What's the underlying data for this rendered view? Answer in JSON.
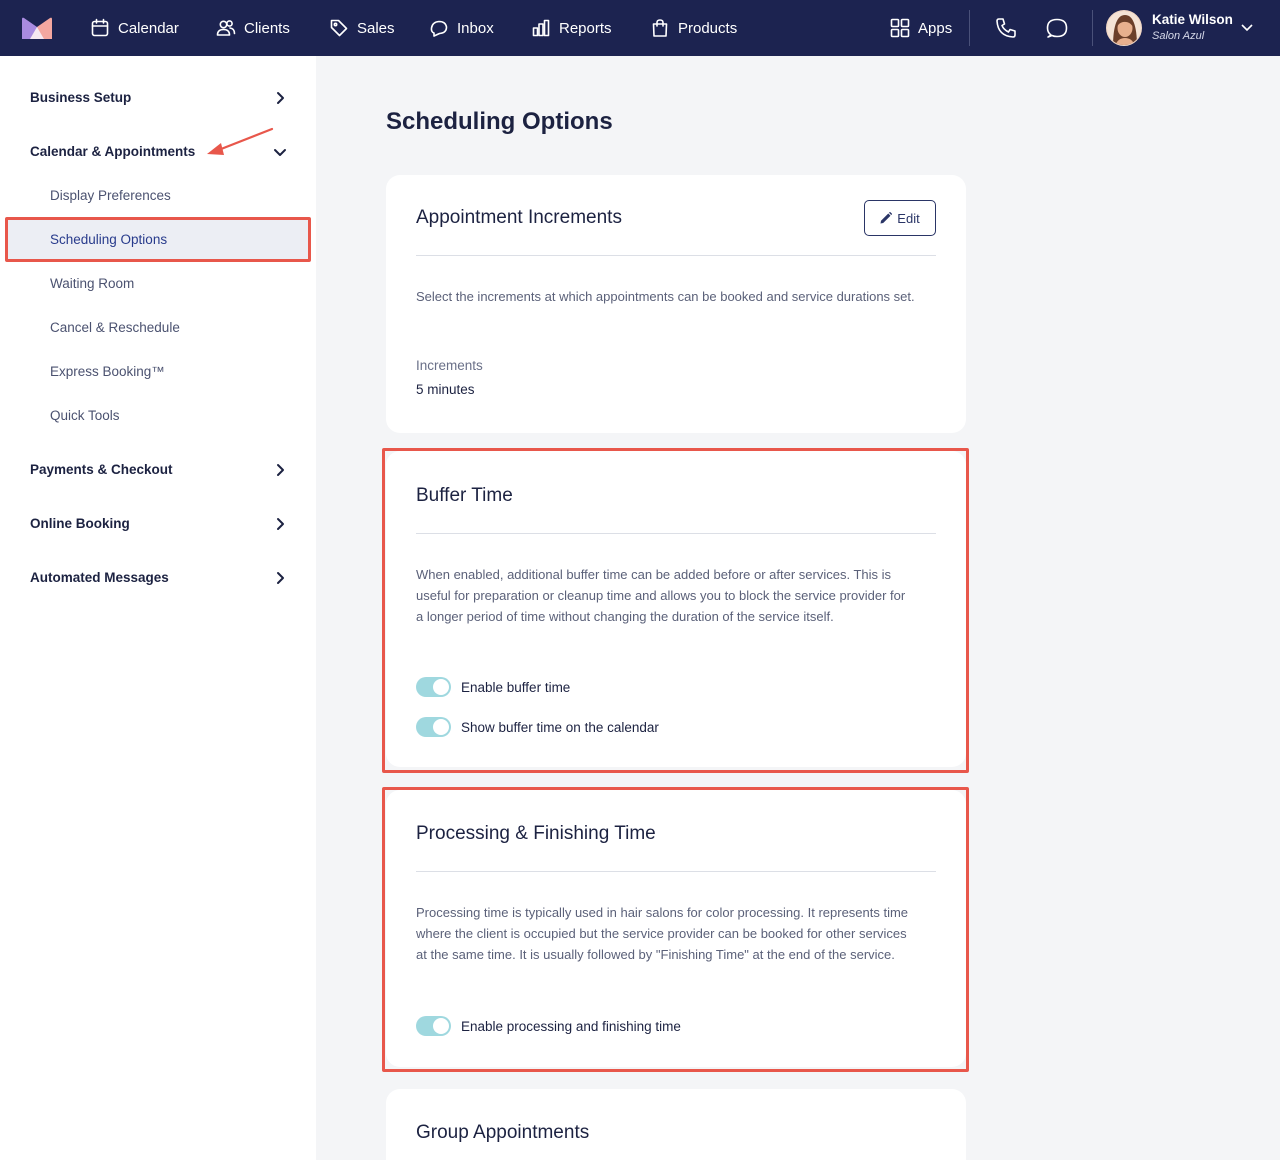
{
  "nav": {
    "items": [
      {
        "label": "Calendar",
        "icon": "calendar-icon"
      },
      {
        "label": "Clients",
        "icon": "users-icon"
      },
      {
        "label": "Sales",
        "icon": "tag-icon"
      },
      {
        "label": "Inbox",
        "icon": "inbox-icon"
      },
      {
        "label": "Reports",
        "icon": "bar-chart-icon"
      },
      {
        "label": "Products",
        "icon": "shopping-bag-icon"
      }
    ],
    "apps_label": "Apps",
    "user": {
      "name": "Katie Wilson",
      "business": "Salon Azul"
    }
  },
  "sidebar": {
    "sections": [
      {
        "label": "Business Setup",
        "expanded": false
      },
      {
        "label": "Calendar & Appointments",
        "expanded": true
      },
      {
        "label": "Payments & Checkout",
        "expanded": false
      },
      {
        "label": "Online Booking",
        "expanded": false
      },
      {
        "label": "Automated Messages",
        "expanded": false
      }
    ],
    "subitems": [
      "Display Preferences",
      "Scheduling Options",
      "Waiting Room",
      "Cancel & Reschedule",
      "Express Booking™",
      "Quick Tools"
    ],
    "active_subitem": "Scheduling Options"
  },
  "main": {
    "title": "Scheduling Options",
    "increments": {
      "title": "Appointment Increments",
      "edit_label": "Edit",
      "description": "Select the increments at which appointments can be booked and service durations set.",
      "field_label": "Increments",
      "field_value": "5 minutes"
    },
    "buffer": {
      "title": "Buffer Time",
      "description": "When enabled, additional buffer time can be added before or after services. This is useful for preparation or cleanup time and allows you to block the service provider for a longer period of time without changing the duration of the service itself.",
      "toggles": [
        {
          "label": "Enable buffer time",
          "on": true
        },
        {
          "label": "Show buffer time on the calendar",
          "on": true
        }
      ]
    },
    "processing": {
      "title": "Processing & Finishing Time",
      "description": "Processing time is typically used in hair salons for color processing. It represents time where the client is occupied but the service provider can be booked for other services at the same time. It is usually followed by \"Finishing Time\" at the end of the service.",
      "toggles": [
        {
          "label": "Enable processing and finishing time",
          "on": true
        }
      ]
    },
    "group": {
      "title": "Group Appointments"
    }
  },
  "colors": {
    "nav_bg": "#1c2350",
    "highlight": "#e8574b",
    "toggle_on": "#9fd8df",
    "active_text": "#283b8c"
  }
}
